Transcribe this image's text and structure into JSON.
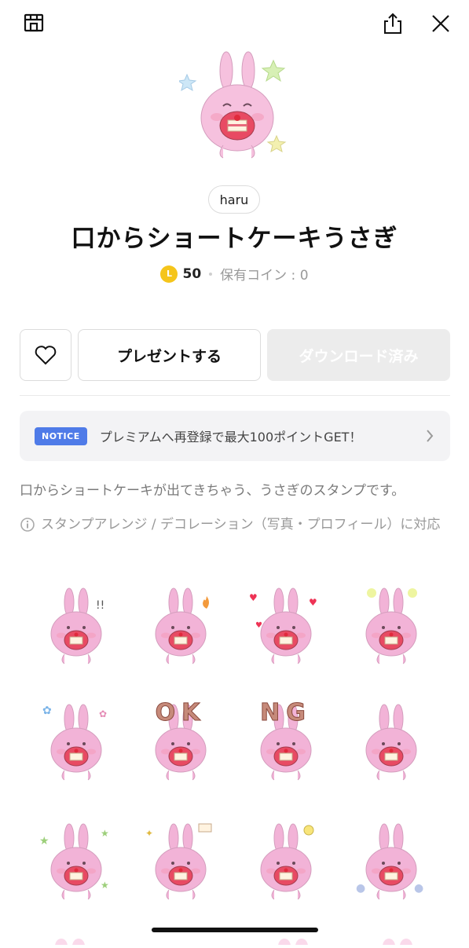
{
  "header": {
    "store_icon": "store-icon",
    "share_icon": "share-icon",
    "close_icon": "close-icon"
  },
  "product": {
    "author": "haru",
    "title": "口からショートケーキうさぎ",
    "price": "50",
    "coin_symbol": "L",
    "owned_coins": "保有コイン : 0"
  },
  "actions": {
    "favorite_icon": "heart-icon",
    "present_label": "プレゼントする",
    "download_label": "ダウンロード済み"
  },
  "notice": {
    "badge": "NOTICE",
    "text": "プレミアムへ再登録で最大100ポイントGET！"
  },
  "description": "口からショートケーキが出てきちゃう、うさぎのスタンプです。",
  "feature": "スタンプアレンジ / デコレーション（写真・プロフィール）に対応",
  "stickers": [
    {
      "deco": "exclaim"
    },
    {
      "deco": "fire"
    },
    {
      "deco": "hearts"
    },
    {
      "deco": "dizzy"
    },
    {
      "deco": "flowers"
    },
    {
      "text": "OK"
    },
    {
      "text": "NG"
    },
    {
      "deco": "worried"
    },
    {
      "deco": "stars"
    },
    {
      "deco": "sparkle-cake"
    },
    {
      "deco": "bulb"
    },
    {
      "deco": "ghost"
    }
  ],
  "colors": {
    "accent": "#4f7be8",
    "coin": "#f5c51b",
    "bunny": "#f2b3d7"
  }
}
